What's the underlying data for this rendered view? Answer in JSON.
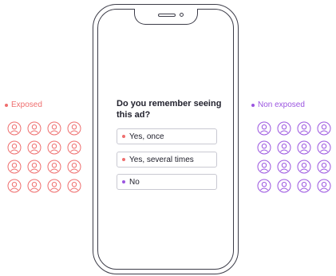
{
  "colors": {
    "exposed": "#ef6e6e",
    "non_exposed": "#9b55e0",
    "phone_outline": "#3c3c48",
    "option_border": "#c9c9d2"
  },
  "exposed_group": {
    "label": "Exposed",
    "icon": "person-icon",
    "count": 16
  },
  "non_exposed_group": {
    "label": "Non exposed",
    "icon": "person-icon",
    "count": 16
  },
  "survey": {
    "question": "Do you remember seeing this ad?",
    "options": [
      {
        "label": "Yes, once",
        "marker": "exposed"
      },
      {
        "label": "Yes, several times",
        "marker": "exposed"
      },
      {
        "label": "No",
        "marker": "non_exposed"
      }
    ]
  }
}
